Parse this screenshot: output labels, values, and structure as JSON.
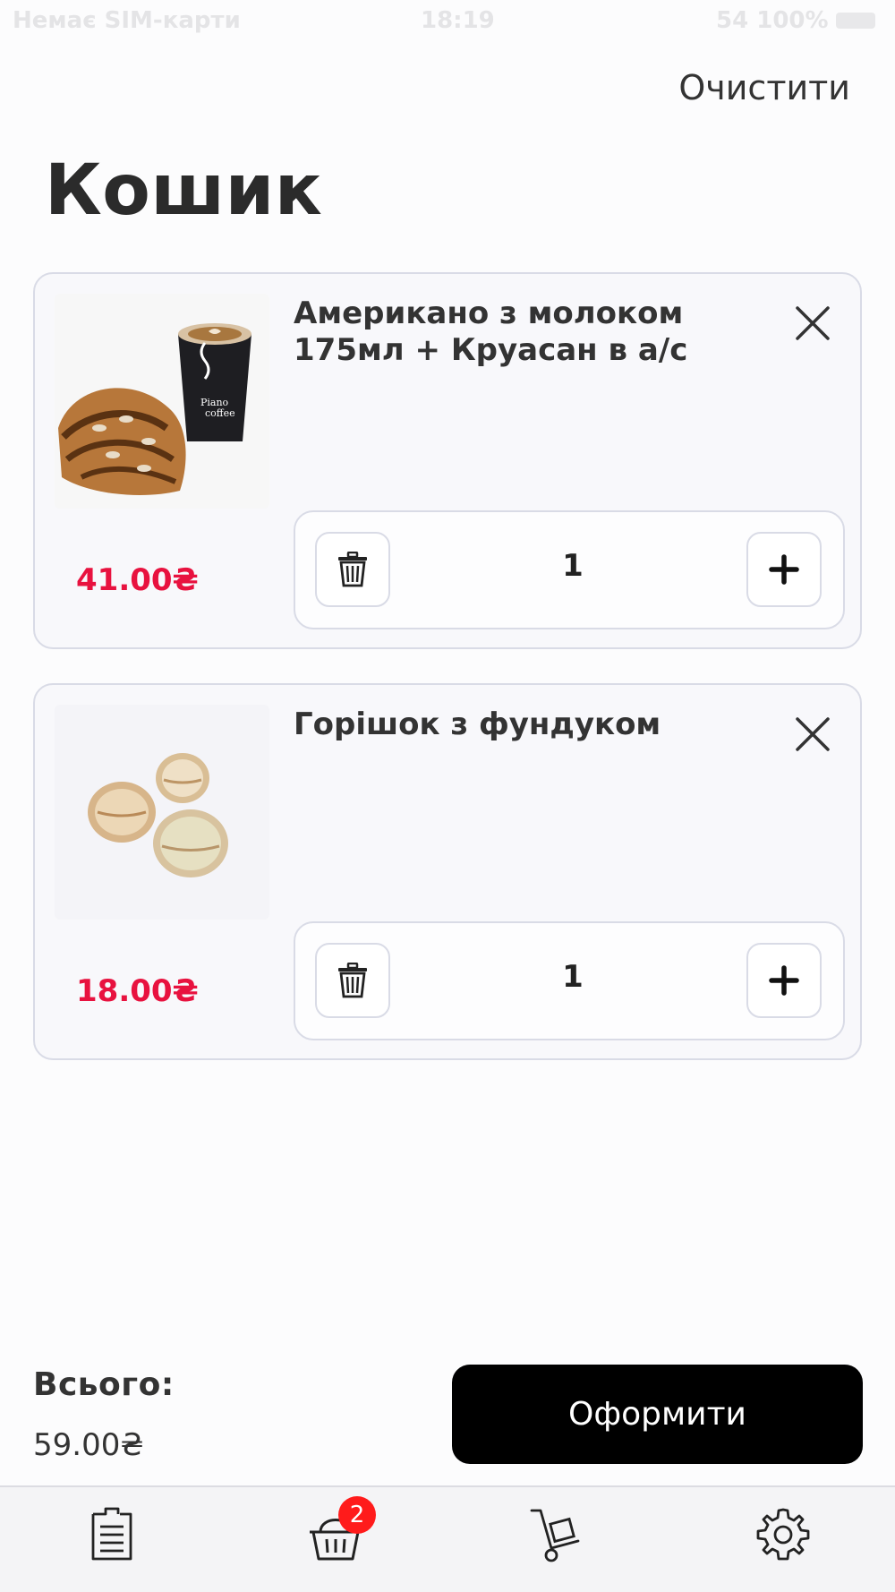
{
  "status_bar": {
    "carrier": "Немає SIM-карти",
    "time": "18:19",
    "battery": "54 100%"
  },
  "header": {
    "clear_label": "Очистити",
    "title": "Кошик"
  },
  "cart": {
    "items": [
      {
        "name": "Американо з молоком 175мл + Круасан в а/с",
        "price": "41.00₴",
        "quantity": "1"
      },
      {
        "name": "Горішок з фундуком",
        "price": "18.00₴",
        "quantity": "1"
      }
    ]
  },
  "summary": {
    "total_label": "Всього:",
    "total_value": "59.00₴",
    "checkout_label": "Оформити"
  },
  "tab_bar": {
    "cart_badge": "2",
    "tabs": [
      {
        "icon": "menu-list-icon"
      },
      {
        "icon": "basket-icon"
      },
      {
        "icon": "delivery-cart-icon"
      },
      {
        "icon": "gear-icon"
      }
    ]
  },
  "colors": {
    "price": "#e8123f",
    "badge": "#ff1b1b",
    "checkout_bg": "#000000"
  }
}
